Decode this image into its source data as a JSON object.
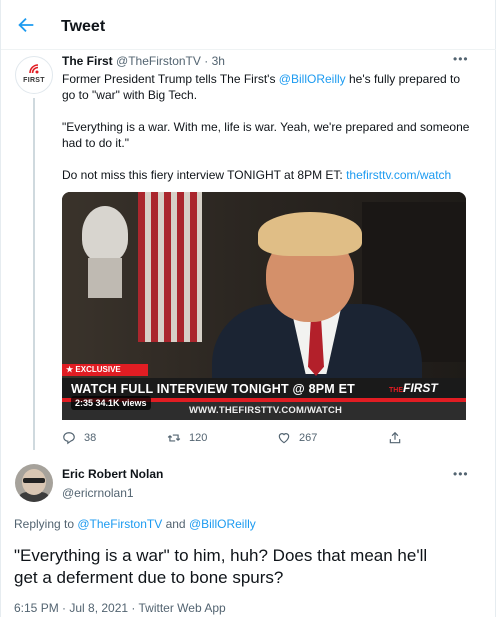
{
  "header": {
    "title": "Tweet",
    "back_icon": "arrow-left-icon"
  },
  "tweet": {
    "author_name": "The First",
    "author_handle": "@TheFirstonTV",
    "separator": "·",
    "time": "3h",
    "avatar_text": "FIRST",
    "line1_prefix": "Former President Trump tells The First's ",
    "mention": "@BillOReilly",
    "line1_suffix": " he's fully prepared to",
    "line2": "go to \"war\" with Big Tech.",
    "quote_line1": "\"Everything is a war. With me, life is war. Yeah, we're prepared and someone",
    "quote_line2": "had to do it.\"",
    "promo_prefix": "Do not miss this fiery interview TONIGHT at 8PM ET: ",
    "promo_link": "thefirsttv.com/watch",
    "media": {
      "exclusive_label": "★ EXCLUSIVE",
      "banner": "WATCH FULL INTERVIEW TONIGHT @ 8PM ET",
      "logo_the": "THE",
      "logo_first": "FIRST",
      "url": "WWW.THEFIRSTTV.COM/WATCH",
      "duration": "2:35",
      "views": "34.1K views"
    },
    "actions": {
      "replies": "38",
      "retweets": "120",
      "likes": "267"
    }
  },
  "reply": {
    "author_name": "Eric Robert Nolan",
    "author_handle": "@ericrnolan1",
    "replying_to_label": "Replying to ",
    "replying_to_1": "@TheFirstonTV",
    "replying_and": " and ",
    "replying_to_2": "@BillOReilly",
    "text_line1": "\"Everything is a war\" to him, huh?  Does that mean he'll",
    "text_line2": "get a deferment due to bone spurs?",
    "timestamp": "6:15 PM · Jul 8, 2021 · Twitter Web App"
  },
  "colors": {
    "accent": "#1d9bf0",
    "muted": "#536471",
    "brand_red": "#e11d23"
  }
}
